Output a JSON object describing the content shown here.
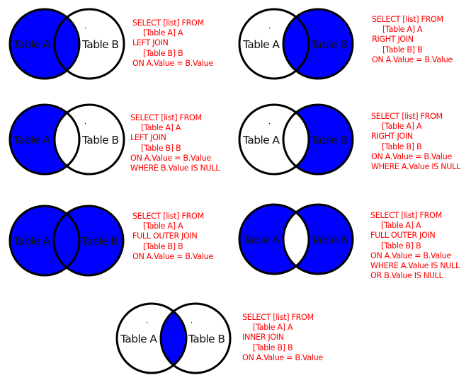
{
  "colors": {
    "fill": "#0000ff",
    "empty": "#ffffff",
    "stroke": "#000000",
    "sql_text": "#ff0000"
  },
  "diagrams": [
    {
      "id": "left-join",
      "label_a": "Table A",
      "label_b": "Table B",
      "shade": {
        "a_only": true,
        "intersection": true,
        "b_only": false
      },
      "sql": [
        {
          "text": "SELECT [list] FROM",
          "indent": false
        },
        {
          "text": "[Table A] A",
          "indent": true
        },
        {
          "text": "LEFT JOIN",
          "indent": false
        },
        {
          "text": "[Table B] B",
          "indent": true
        },
        {
          "text": "ON A.Value = B.Value",
          "indent": false
        }
      ]
    },
    {
      "id": "right-join",
      "label_a": "Table A",
      "label_b": "Table B",
      "shade": {
        "a_only": false,
        "intersection": true,
        "b_only": true
      },
      "sql": [
        {
          "text": "SELECT [list] FROM",
          "indent": false
        },
        {
          "text": "[Table A] A",
          "indent": true
        },
        {
          "text": "RIGHT JOIN",
          "indent": false
        },
        {
          "text": "[Table B] B",
          "indent": true
        },
        {
          "text": "ON A.Value = B.Value",
          "indent": false
        }
      ]
    },
    {
      "id": "left-join-exclusive",
      "label_a": "Table A",
      "label_b": "Table B",
      "shade": {
        "a_only": true,
        "intersection": false,
        "b_only": false
      },
      "sql": [
        {
          "text": "SELECT [list] FROM",
          "indent": false
        },
        {
          "text": "[Table A] A",
          "indent": true
        },
        {
          "text": "LEFT JOIN",
          "indent": false
        },
        {
          "text": "[Table B] B",
          "indent": true
        },
        {
          "text": "ON A.Value = B.Value",
          "indent": false
        },
        {
          "text": "WHERE B.Value IS NULL",
          "indent": false
        }
      ]
    },
    {
      "id": "right-join-exclusive",
      "label_a": "Table A",
      "label_b": "Table B",
      "shade": {
        "a_only": false,
        "intersection": false,
        "b_only": true
      },
      "sql": [
        {
          "text": "SELECT [list] FROM",
          "indent": false
        },
        {
          "text": "[Table A] A",
          "indent": true
        },
        {
          "text": "RIGHT JOIN",
          "indent": false
        },
        {
          "text": "[Table B] B",
          "indent": true
        },
        {
          "text": "ON A.Value = B.Value",
          "indent": false
        },
        {
          "text": "WHERE A.Value IS NULL",
          "indent": false
        }
      ]
    },
    {
      "id": "full-outer-join",
      "label_a": "Table A",
      "label_b": "Table B",
      "shade": {
        "a_only": true,
        "intersection": true,
        "b_only": true
      },
      "sql": [
        {
          "text": "SELECT [list] FROM",
          "indent": false
        },
        {
          "text": "[Table A] A",
          "indent": true
        },
        {
          "text": "FULL OUTER JOIN",
          "indent": false
        },
        {
          "text": "[Table B] B",
          "indent": true
        },
        {
          "text": "ON A.Value = B.Value",
          "indent": false
        }
      ]
    },
    {
      "id": "full-outer-join-exclusive",
      "label_a": "Table A",
      "label_b": "Table B",
      "shade": {
        "a_only": true,
        "intersection": false,
        "b_only": true
      },
      "sql": [
        {
          "text": "SELECT [list] FROM",
          "indent": false
        },
        {
          "text": "[Table A] A",
          "indent": true
        },
        {
          "text": "FULL OUTER JOIN",
          "indent": false
        },
        {
          "text": "[Table B] B",
          "indent": true
        },
        {
          "text": "ON A.Value = B.Value",
          "indent": false
        },
        {
          "text": "WHERE A.Value IS NULL",
          "indent": false
        },
        {
          "text": "OR B.Value IS NULL",
          "indent": false
        }
      ]
    },
    {
      "id": "inner-join",
      "label_a": "Table A",
      "label_b": "Table B",
      "shade": {
        "a_only": false,
        "intersection": true,
        "b_only": false
      },
      "sql": [
        {
          "text": "SELECT [list] FROM",
          "indent": false
        },
        {
          "text": "[Table A] A",
          "indent": true
        },
        {
          "text": "INNER JOIN",
          "indent": false
        },
        {
          "text": "[Table B] B",
          "indent": true
        },
        {
          "text": "ON A.Value = B.Value",
          "indent": false
        }
      ]
    }
  ]
}
